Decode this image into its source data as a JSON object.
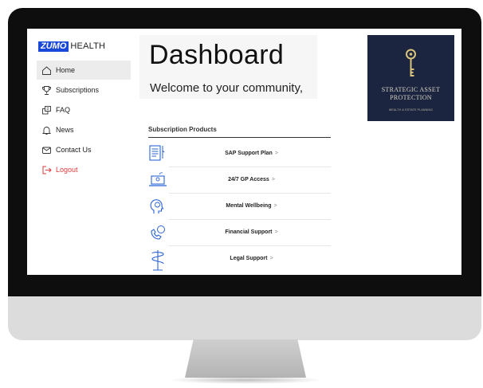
{
  "sidebar": {
    "logo_badge": "ZUMO",
    "logo_text": "HEALTH",
    "items": [
      {
        "label": "Home",
        "icon": "home-icon"
      },
      {
        "label": "Subscriptions",
        "icon": "trophy-icon"
      },
      {
        "label": "FAQ",
        "icon": "faq-icon"
      },
      {
        "label": "News",
        "icon": "bell-icon"
      },
      {
        "label": "Contact Us",
        "icon": "mail-icon"
      },
      {
        "label": "Logout",
        "icon": "logout-icon"
      }
    ],
    "active_item": "Home"
  },
  "header": {
    "title": "Dashboard",
    "welcome": "Welcome to your community,"
  },
  "brand": {
    "line1": "STRATEGIC ASSET",
    "line2": "PROTECTION",
    "tagline": "WEALTH & ESTATE PLANNING"
  },
  "products": {
    "heading": "Subscription Products",
    "chevron": ">",
    "items": [
      {
        "label": "SAP Support Plan",
        "icon": "document-icon"
      },
      {
        "label": "24/7 GP Access",
        "icon": "laptop-icon"
      },
      {
        "label": "Mental Wellbeing",
        "icon": "head-icon"
      },
      {
        "label": "Financial Support",
        "icon": "phone-icon"
      },
      {
        "label": "Legal Support",
        "icon": "scales-icon"
      }
    ]
  },
  "colors": {
    "accent": "#1a49d9",
    "logout": "#e0393e",
    "icon_blue": "#2b63d6",
    "brand_bg": "#1c2540"
  }
}
